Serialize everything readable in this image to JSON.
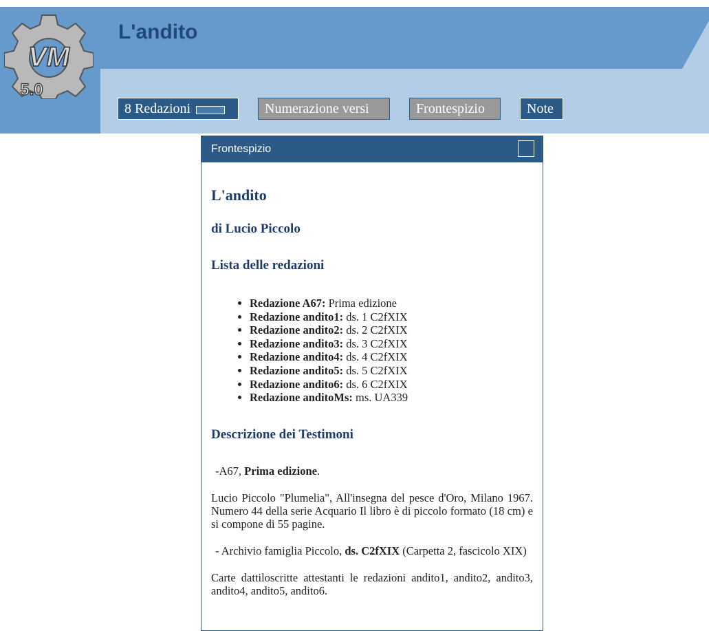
{
  "header": {
    "app_title": "L'andito",
    "logo_text": "5.0",
    "logo_letters": "VM"
  },
  "toolbar": {
    "redazioni_label": "8 Redazioni",
    "numerazione_label": "Numerazione versi",
    "frontespizio_label": "Frontespizio",
    "note_label": "Note"
  },
  "panel": {
    "title": "Frontespizio",
    "heading": "L'andito",
    "author": "di Lucio Piccolo",
    "list_heading": "Lista delle redazioni",
    "redazioni": [
      {
        "name": "Redazione A67:",
        "desc": " Prima edizione"
      },
      {
        "name": "Redazione andito1:",
        "desc": " ds. 1 C2fXIX"
      },
      {
        "name": "Redazione andito2:",
        "desc": " ds. 2 C2fXIX"
      },
      {
        "name": "Redazione andito3:",
        "desc": " ds. 3 C2fXIX"
      },
      {
        "name": "Redazione andito4:",
        "desc": " ds. 4 C2fXIX"
      },
      {
        "name": "Redazione andito5:",
        "desc": " ds. 5 C2fXIX"
      },
      {
        "name": "Redazione andito6:",
        "desc": " ds. 6 C2fXIX"
      },
      {
        "name": "Redazione anditoMs:",
        "desc": " ms. UA339"
      }
    ],
    "testimoni_heading": "Descrizione dei Testimoni",
    "t1_prefix": "-A67, ",
    "t1_bold": "Prima edizione",
    "t1_suffix": ".",
    "t1_text": "Lucio Piccolo \"Plumelia\", All'insegna del pesce d'Oro, Milano 1967. Numero 44 della serie Acquario Il libro è di piccolo formato (18 cm) e si compone di 55 pagine.",
    "t2_prefix": "- Archivio famiglia Piccolo, ",
    "t2_bold": "ds. C2fXIX",
    "t2_suffix": " (Carpetta 2, fascicolo XIX)",
    "t2_text": "Carte dattiloscritte attestanti le redazioni andito1, andito2, andito3, andito4, andito5, andito6."
  }
}
